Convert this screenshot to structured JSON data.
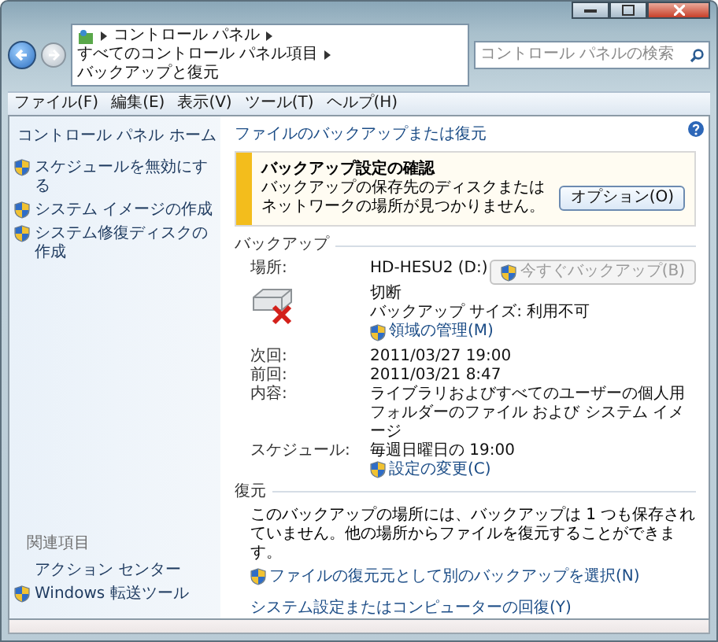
{
  "address_bar": {
    "breadcrumb": [
      "コントロール パネル",
      "すべてのコントロール パネル項目",
      "バックアップと復元"
    ],
    "search": {
      "placeholder": "コントロール パネルの検索"
    }
  },
  "menu": [
    "ファイル(F)",
    "編集(E)",
    "表示(V)",
    "ツール(T)",
    "ヘルプ(H)"
  ],
  "sidebar": {
    "home": "コントロール パネル ホーム",
    "tasks": [
      {
        "label": "スケジュールを無効にする",
        "shield": true
      },
      {
        "label": "システム イメージの作成",
        "shield": true
      },
      {
        "label": "システム修復ディスクの作成",
        "shield": true
      }
    ],
    "see_also": {
      "heading": "関連項目",
      "items": [
        {
          "label": "アクション センター",
          "shield": false
        },
        {
          "label": "Windows 転送ツール",
          "shield": true
        }
      ]
    }
  },
  "main": {
    "title": "ファイルのバックアップまたは復元",
    "alert": {
      "title": "バックアップ設定の確認",
      "message": "バックアップの保存先のディスクまたはネットワークの場所が見つかりません。",
      "button": "オプション(O)"
    },
    "backup": {
      "heading": "バックアップ",
      "location_label": "場所:",
      "location_lines": [
        "HD-HESU2 (D:)",
        "切断",
        "バックアップ サイズ: 利用不可"
      ],
      "manage_link": "領域の管理(M)",
      "backup_now": {
        "label": "今すぐバックアップ(B)",
        "disabled": true
      },
      "details": [
        {
          "label": "次回:",
          "value": "2011/03/27 19:00"
        },
        {
          "label": "前回:",
          "value": "2011/03/21 8:47"
        },
        {
          "label": "内容:",
          "value": "ライブラリおよびすべてのユーザーの個人用フォルダーのファイル および システム イメージ"
        },
        {
          "label": "スケジュール:",
          "value": "毎週日曜日の 19:00"
        }
      ],
      "settings_link": "設定の変更(C)"
    },
    "restore": {
      "heading": "復元",
      "message": "このバックアップの場所には、バックアップは 1 つも保存されていません。他の場所からファイルを復元することができます。",
      "links": [
        {
          "label": "ファイルの復元元として別のバックアップを選択(N)",
          "shield": true
        },
        {
          "label": "システム設定またはコンピューターの回復(Y)",
          "shield": false
        }
      ]
    }
  }
}
